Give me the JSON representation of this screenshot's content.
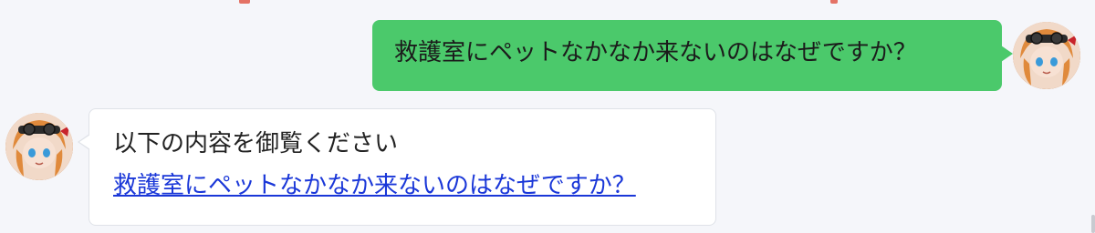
{
  "messages": [
    {
      "role": "user",
      "text": "救護室にペットなかなか来ないのはなぜですか？",
      "avatar_icon": "anime-girl-avatar"
    },
    {
      "role": "bot",
      "intro": "以下の内容を御覧ください",
      "link_text": "救護室にペットなかなか来ないのはなぜですか？",
      "avatar_icon": "anime-girl-avatar"
    }
  ],
  "colors": {
    "user_bubble": "#4bc96b",
    "bot_bubble": "#ffffff",
    "link": "#1a37d8",
    "background": "#f5f6fa"
  }
}
